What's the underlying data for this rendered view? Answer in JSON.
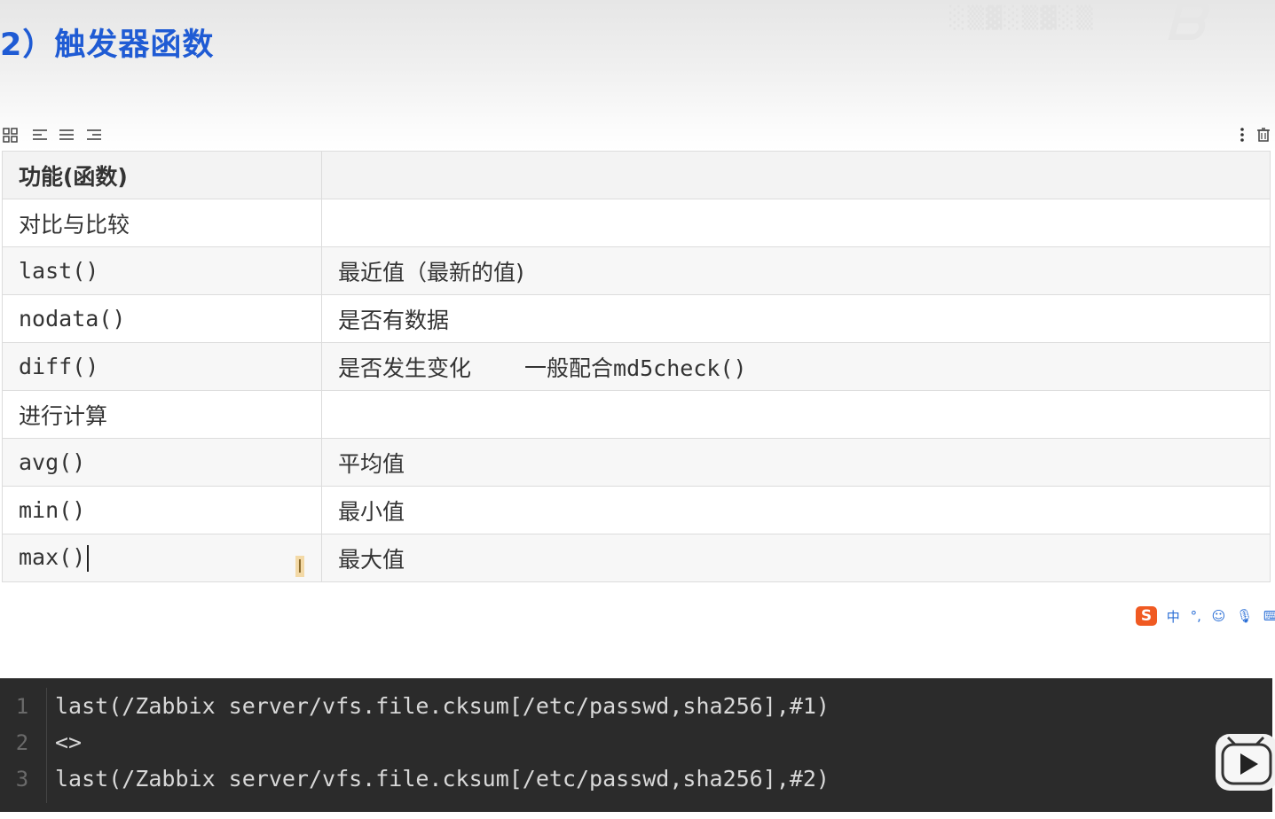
{
  "heading": "2）触发器函数",
  "table": {
    "header": [
      "功能(函数)",
      ""
    ],
    "rows": [
      {
        "c1": "对比与比较",
        "c2": ""
      },
      {
        "c1": "last()",
        "c2": "最近值（最新的值)"
      },
      {
        "c1": "nodata()",
        "c2": "是否有数据"
      },
      {
        "c1": "diff()",
        "c2": "是否发生变化",
        "c2_note": "一般配合md5check()"
      },
      {
        "c1": "进行计算",
        "c2": ""
      },
      {
        "c1": "avg()",
        "c2": "平均值"
      },
      {
        "c1": "min()",
        "c2": "最小值"
      },
      {
        "c1": "max()",
        "c2": "最大值"
      }
    ]
  },
  "ime": {
    "logo": "S",
    "items": [
      "中",
      "°,",
      "☺",
      "🎙",
      "⌨",
      "👤"
    ]
  },
  "code": {
    "lines": [
      {
        "num": "1",
        "text": "last(/Zabbix server/vfs.file.cksum[/etc/passwd,sha256],#1)"
      },
      {
        "num": "2",
        "text": "<>"
      },
      {
        "num": "3",
        "text": "last(/Zabbix server/vfs.file.cksum[/etc/passwd,sha256],#2)"
      }
    ]
  }
}
